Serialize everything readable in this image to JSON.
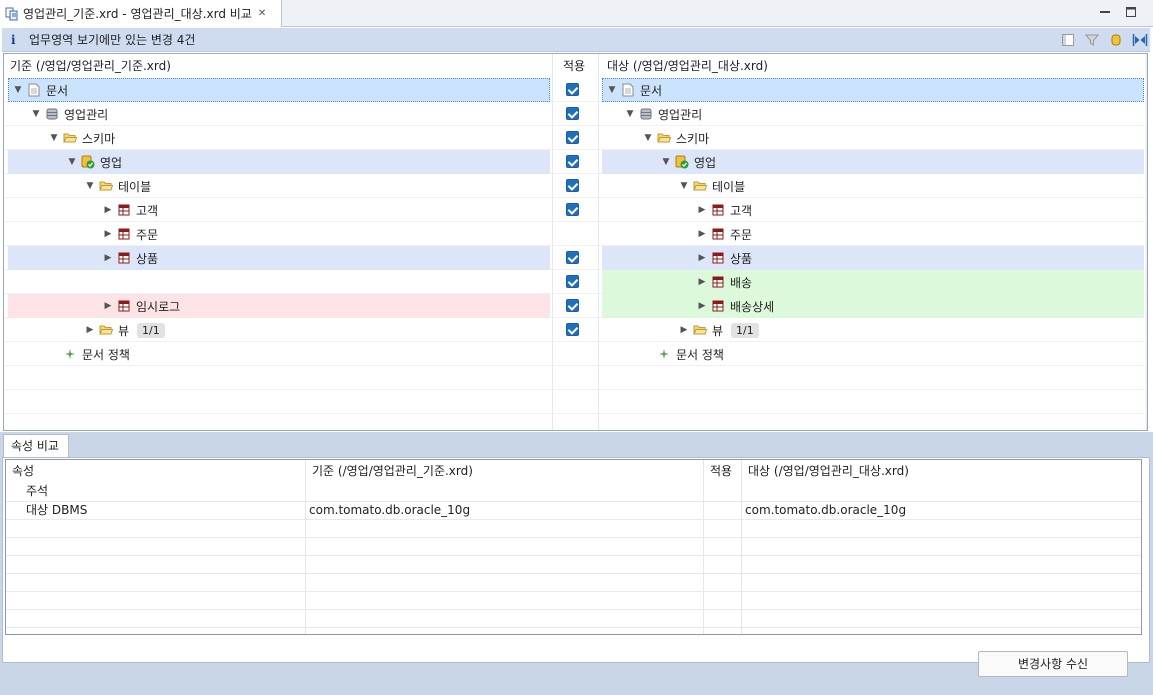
{
  "tab": {
    "title": "영업관리_기준.xrd - 영업관리_대상.xrd 비교",
    "icon": "compare-document-icon",
    "close_icon": "close-icon"
  },
  "window": {
    "minimize_icon": "minimize-icon",
    "maximize_icon": "maximize-icon"
  },
  "info": {
    "icon": "info-icon",
    "text": "업무영역 보기에만 있는 변경 4건"
  },
  "toolbar": {
    "icons": [
      "layout-icon",
      "filter-icon",
      "cylinder-icon",
      "swap-compare-icon"
    ]
  },
  "columns": {
    "left": "기준 (/영업/영업관리_기준.xrd)",
    "apply": "적용",
    "right": "대상 (/영업/영업관리_대상.xrd)"
  },
  "tree": {
    "left": [
      {
        "label": "문서",
        "icon": "document-icon",
        "arrow": "▼",
        "badge": ""
      },
      {
        "label": "영업관리",
        "icon": "database-icon",
        "arrow": "▼",
        "badge": ""
      },
      {
        "label": "스키마",
        "icon": "folder-open-icon",
        "arrow": "▼",
        "badge": ""
      },
      {
        "label": "영업",
        "icon": "schema-check-icon",
        "arrow": "▼",
        "badge": ""
      },
      {
        "label": "테이블",
        "icon": "folder-open-icon",
        "arrow": "▼",
        "badge": ""
      },
      {
        "label": "고객",
        "icon": "table-icon",
        "arrow": "▶",
        "badge": ""
      },
      {
        "label": "주문",
        "icon": "table-icon",
        "arrow": "▶",
        "badge": ""
      },
      {
        "label": "상품",
        "icon": "table-icon",
        "arrow": "▶",
        "badge": ""
      },
      {
        "label": "임시로그",
        "icon": "table-icon",
        "arrow": "▶",
        "badge": ""
      },
      {
        "label": "뷰",
        "icon": "folder-open-icon",
        "arrow": "▶",
        "badge": "1/1"
      },
      {
        "label": "문서 정책",
        "icon": "policy-icon",
        "arrow": "",
        "badge": ""
      }
    ],
    "right": [
      {
        "label": "문서",
        "icon": "document-icon",
        "arrow": "▼",
        "badge": ""
      },
      {
        "label": "영업관리",
        "icon": "database-icon",
        "arrow": "▼",
        "badge": ""
      },
      {
        "label": "스키마",
        "icon": "folder-open-icon",
        "arrow": "▼",
        "badge": ""
      },
      {
        "label": "영업",
        "icon": "schema-check-icon",
        "arrow": "▼",
        "badge": ""
      },
      {
        "label": "테이블",
        "icon": "folder-open-icon",
        "arrow": "▼",
        "badge": ""
      },
      {
        "label": "고객",
        "icon": "table-icon",
        "arrow": "▶",
        "badge": ""
      },
      {
        "label": "주문",
        "icon": "table-icon",
        "arrow": "▶",
        "badge": ""
      },
      {
        "label": "상품",
        "icon": "table-icon",
        "arrow": "▶",
        "badge": ""
      },
      {
        "label": "배송",
        "icon": "table-icon",
        "arrow": "▶",
        "badge": ""
      },
      {
        "label": "배송상세",
        "icon": "table-icon",
        "arrow": "▶",
        "badge": ""
      },
      {
        "label": "뷰",
        "icon": "folder-open-icon",
        "arrow": "▶",
        "badge": "1/1"
      },
      {
        "label": "문서 정책",
        "icon": "policy-icon",
        "arrow": "",
        "badge": ""
      }
    ]
  },
  "colors": {
    "selected": "#cce4fb",
    "changed": "#dce6f8",
    "removed": "#fbe3e6",
    "added": "#dcf9dc",
    "checkbox": "#1f6fbf"
  },
  "properties": {
    "tab_label": "속성 비교",
    "headers": {
      "name": "속성",
      "left": "기준 (/영업/영업관리_기준.xrd)",
      "apply": "적용",
      "right": "대상 (/영업/영업관리_대상.xrd)"
    },
    "rows": [
      {
        "name": "주석",
        "left": "",
        "right": ""
      },
      {
        "name": "대상 DBMS",
        "left": "com.tomato.db.oracle_10g",
        "right": "com.tomato.db.oracle_10g"
      }
    ]
  },
  "receive_button": "변경사항 수신"
}
